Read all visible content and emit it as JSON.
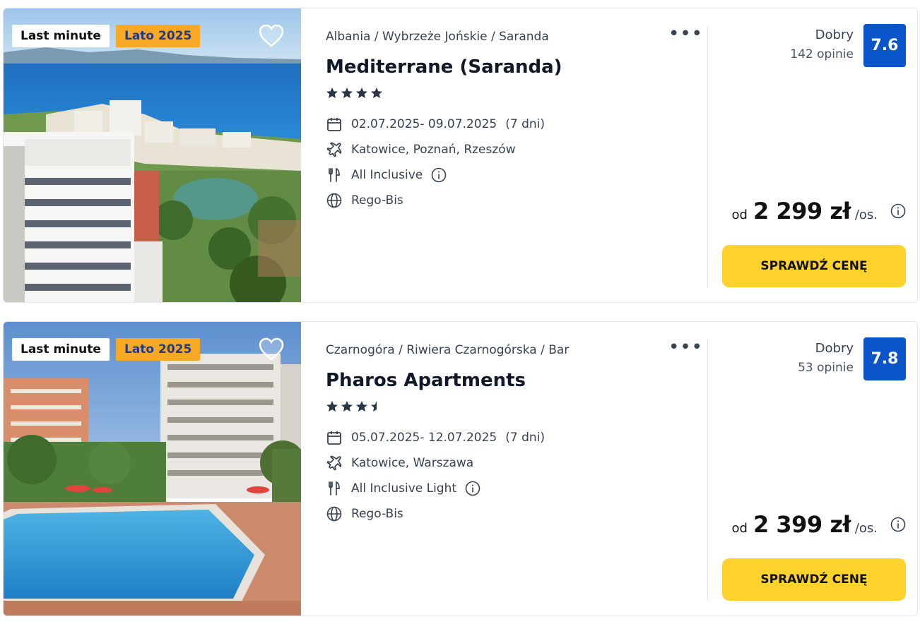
{
  "offers": [
    {
      "badge_primary": "Last minute",
      "badge_secondary": "Lato 2025",
      "breadcrumb": "Albania / Wybrzeże Jońskie / Saranda",
      "name": "Mediterrane (Saranda)",
      "stars": 4,
      "dates": "02.07.2025- 09.07.2025",
      "duration": "(7 dni)",
      "departures": "Katowice, Poznań, Rzeszów",
      "board": "All Inclusive",
      "operator": "Rego-Bis",
      "rating_label": "Dobry",
      "reviews": "142 opinie",
      "score": "7.6",
      "price_prefix": "od",
      "price": "2 299 zł",
      "price_suffix": "/os.",
      "cta": "SPRAWDŹ CENĘ",
      "more_icon": "more-dots-icon"
    },
    {
      "badge_primary": "Last minute",
      "badge_secondary": "Lato 2025",
      "breadcrumb": "Czarnogóra / Riwiera Czarnogórska / Bar",
      "name": "Pharos Apartments",
      "stars": 3.5,
      "dates": "05.07.2025- 12.07.2025",
      "duration": "(7 dni)",
      "departures": "Katowice, Warszawa",
      "board": "All Inclusive Light",
      "operator": "Rego-Bis",
      "rating_label": "Dobry",
      "reviews": "53 opinie",
      "score": "7.8",
      "price_prefix": "od",
      "price": "2 399 zł",
      "price_suffix": "/os.",
      "cta": "SPRAWDŹ CENĘ",
      "more_icon": "more-dots-icon"
    }
  ],
  "colors": {
    "score_bg": "#0a55c9",
    "cta_bg": "#fed22c",
    "badge_orange": "#f7a825",
    "star": "#2b3444"
  },
  "icons": [
    "heart-icon",
    "calendar-icon",
    "plane-icon",
    "cutlery-icon",
    "info-icon",
    "globe-icon",
    "star-icon"
  ]
}
